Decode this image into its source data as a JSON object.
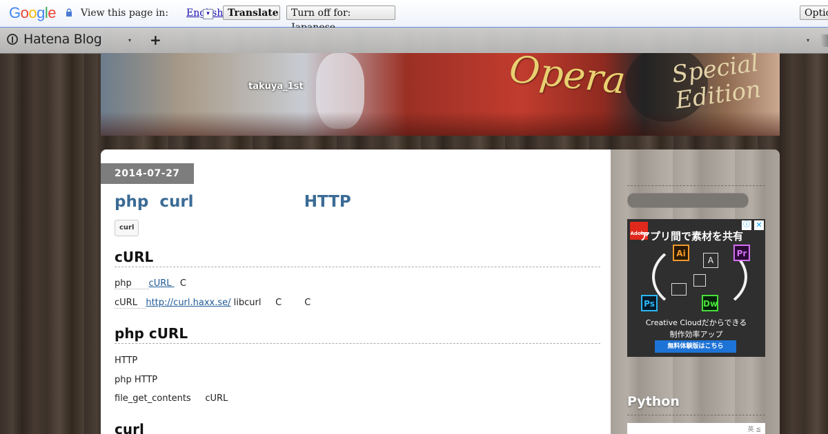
{
  "translate_bar": {
    "logo": "Google",
    "view_prompt": "View this page in:",
    "language": "English",
    "language_arrow": "▾",
    "translate_label": "Translate",
    "turn_off_label": "Turn off for: Japanese",
    "options_label": "Options"
  },
  "header": {
    "logo_text": "Hatena Blog",
    "dropdown_arrow": "▾",
    "add_label": "+",
    "right_arrow": "▾"
  },
  "banner": {
    "blog_title": "takuya_1st",
    "photo_text_1": "Opera",
    "photo_text_2": "Special\nEdition"
  },
  "entry": {
    "date": "2014-07-27",
    "title": "php  curl                    HTTP",
    "tag": "curl",
    "sections": [
      {
        "heading": "cURL",
        "lines": [
          {
            "before": "php      ",
            "link": "cURL ",
            "after": "  C"
          },
          {
            "before": "cURL   ",
            "link": "http://curl.haxx.se/",
            "after": " libcurl     C        C"
          }
        ]
      },
      {
        "heading": "php cURL",
        "lines": [
          {
            "text": "HTTP"
          },
          {
            "text": "php HTTP"
          },
          {
            "text": "file_get_contents     cURL"
          }
        ]
      },
      {
        "heading": "curl"
      }
    ]
  },
  "sidebar": {
    "ad": {
      "adobe_label": "Adobe",
      "info_icon": "ⓘ",
      "close_icon": "✕",
      "headline": "アプリ間で素材を共有",
      "apps": [
        "Ai",
        "Pr",
        "Ps",
        "Dw"
      ],
      "a_label": "A",
      "cc_line1": "Creative Cloudだからできる",
      "cc_line2": "制作効率アップ",
      "cta": "無料体験版はこちら"
    },
    "section_heading": "Python",
    "box_text": "英 ≦"
  },
  "colors": {
    "title_link": "#3b6b95",
    "date_badge": "#7d7d7d",
    "gt_border": "#6b90da"
  }
}
